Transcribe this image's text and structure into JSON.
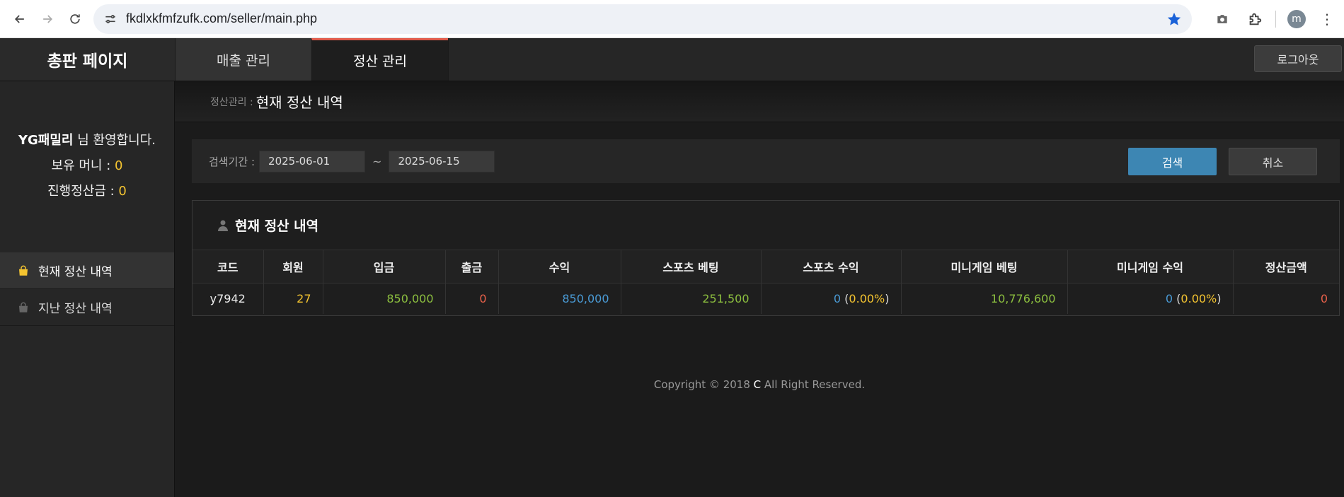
{
  "browser": {
    "url": "fkdlxkfmfzufk.com/seller/main.php",
    "avatar_letter": "m"
  },
  "header": {
    "brand": "총판 페이지",
    "tabs": [
      {
        "label": "매출 관리"
      },
      {
        "label": "정산 관리"
      }
    ],
    "logout": "로그아웃",
    "active_tab_color": "#e05a4a"
  },
  "sidebar": {
    "user_name": "YG패밀리",
    "welcome_suffix": " 님 환영합니다.",
    "money_label": "보유 머니 : ",
    "money_value": "0",
    "pending_label": "진행정산금 : ",
    "pending_value": "0",
    "items": [
      {
        "label": "현재 정산 내역"
      },
      {
        "label": "지난 정산 내역"
      }
    ]
  },
  "breadcrumb": {
    "parent": "정산관리 :",
    "current": "현재 정산 내역"
  },
  "search": {
    "label": "검색기간 :",
    "start_date": "2025-06-01",
    "separator": "~",
    "end_date": "2025-06-15",
    "search_button": "검색",
    "cancel_button": "취소",
    "search_button_color": "#3d86b3"
  },
  "table": {
    "title": "현재 정산 내역",
    "columns": [
      "코드",
      "회원",
      "입금",
      "출금",
      "수익",
      "스포츠 베팅",
      "스포츠 수익",
      "미니게임 베팅",
      "미니게임 수익",
      "정산금액"
    ],
    "rows": [
      {
        "code": "y7942",
        "members": "27",
        "deposit": "850,000",
        "withdraw": "0",
        "profit": "850,000",
        "sports_bet": "251,500",
        "sports_profit": "0",
        "sports_pct": "0.00%",
        "mini_bet": "10,776,600",
        "mini_profit": "0",
        "mini_pct": "0.00%",
        "settlement": "0"
      }
    ]
  },
  "footer": {
    "copyright_prefix": "Copyright © 2018 ",
    "copyright_mark": "C",
    "copyright_suffix": " All Right Reserved."
  }
}
